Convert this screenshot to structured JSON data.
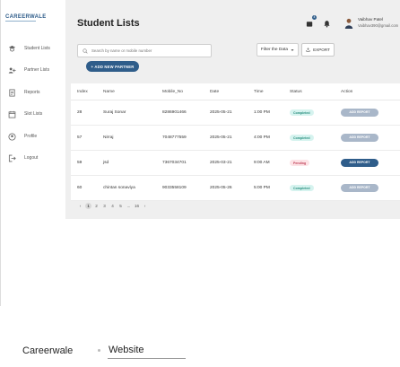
{
  "app": {
    "logo": "CAREERWALE",
    "sidebar": [
      {
        "label": "Student Lists",
        "icon": "student-icon"
      },
      {
        "label": "Partner Lists",
        "icon": "partner-icon"
      },
      {
        "label": "Reports",
        "icon": "report-icon"
      },
      {
        "label": "Slot Lists",
        "icon": "calendar-icon"
      },
      {
        "label": "Profile",
        "icon": "profile-icon"
      },
      {
        "label": "Logout",
        "icon": "logout-icon"
      }
    ],
    "header": {
      "title": "Student Lists",
      "notification_count": "4",
      "user_name": "Vaibhav Patel",
      "user_email": "Vaibhav390@gmail.com"
    },
    "search": {
      "placeholder": "Search by name or mobile number"
    },
    "filter": {
      "label": "Filter the Data"
    },
    "export": {
      "label": "EXPORT"
    },
    "add_button": {
      "label": "+ ADD NEW PARTNER"
    },
    "table": {
      "headers": [
        "Index",
        "Name",
        "Mobile_No",
        "Date",
        "Time",
        "Status",
        "Action"
      ],
      "rows": [
        {
          "index": "28",
          "name": "Suraj Sonar",
          "mobile": "8286901466",
          "date": "2025-05-21",
          "time": "1:00 PM",
          "status": "Completed",
          "action": "ADD REPORT"
        },
        {
          "index": "57",
          "name": "Nirraj",
          "mobile": "7048777559",
          "date": "2025-05-21",
          "time": "4:00 PM",
          "status": "Completed",
          "action": "ADD REPORT"
        },
        {
          "index": "59",
          "name": "jsd",
          "mobile": "7367034701",
          "date": "2025-03-21",
          "time": "9:00 AM",
          "status": "Pending",
          "action": "ADD REPORT"
        },
        {
          "index": "60",
          "name": "chintan sonaviya",
          "mobile": "9033558109",
          "date": "2025-05-26",
          "time": "5:00 PM",
          "status": "Completed",
          "action": "ADD REPORT"
        }
      ]
    },
    "pagination": {
      "prev": "‹",
      "pages": [
        "1",
        "2",
        "3",
        "4",
        "5",
        "...",
        "16"
      ],
      "next": "›",
      "current": "1"
    },
    "colors": {
      "primary": "#2f5d8a",
      "completed_bg": "#d6f3ef",
      "completed_text": "#2a8f7f",
      "pending_bg": "#fde3e6",
      "pending_text": "#c0425a",
      "report_btn_disabled": "#a9b7c9",
      "report_btn_active": "#2f5d8a"
    }
  },
  "caption": {
    "site": "Careerwale",
    "type": "Website"
  }
}
